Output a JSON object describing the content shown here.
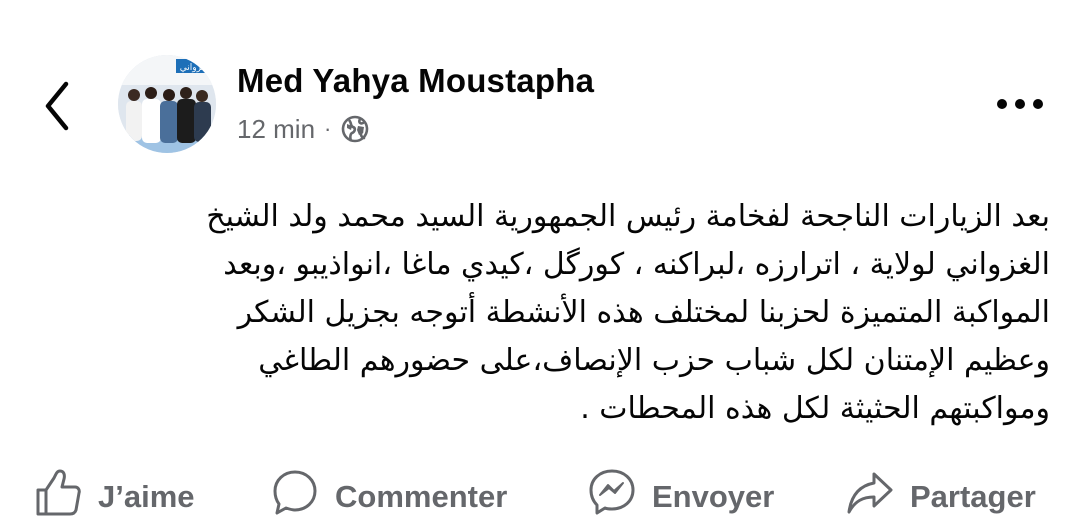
{
  "post": {
    "author": "Med Yahya Moustapha",
    "time": "12 min",
    "separator": "·",
    "audience_icon": "globe-icon",
    "avatar_banner_text": "غزواني",
    "text_lines": [
      "بعد الزيارات الناجحة لفخامة رئيس الجمهورية السيد محمد ولد الشيخ",
      "الغزواني لولاية ، اترارزه ،لبراكنه ، كورگل ،كيدي ماغا ،انواذيبو ،وبعد",
      "المواكبة المتميزة لحزبنا لمختلف هذه الأنشطة أتوجه بجزيل الشكر",
      "وعظيم الإمتنان لكل شباب حزب الإنصاف،على حضورهم الطاغي",
      "ومواكبتهم الحثيثة لكل هذه المحطات ."
    ]
  },
  "actions": {
    "like": "J’aime",
    "comment": "Commenter",
    "send": "Envoyer",
    "share": "Partager"
  },
  "icons": {
    "back": "chevron-left-icon",
    "more": "more-horizontal-icon",
    "like": "thumbs-up-icon",
    "comment": "comment-bubble-icon",
    "send": "messenger-icon",
    "share": "share-arrow-icon"
  },
  "colors": {
    "text": "#050505",
    "secondary": "#65676b",
    "background": "#ffffff"
  }
}
